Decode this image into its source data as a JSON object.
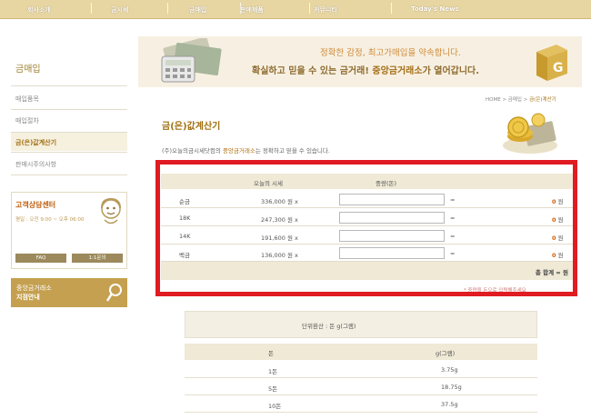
{
  "nav": {
    "items": [
      "회사소개",
      "금시세",
      "금매입",
      "판매제품",
      "커뮤니티",
      "Today's News"
    ]
  },
  "sidebar": {
    "title": "금매입",
    "items": [
      {
        "label": "매입품목",
        "active": false
      },
      {
        "label": "매입절차",
        "active": false
      },
      {
        "label": "금(은)값계산기",
        "active": true
      },
      {
        "label": "판매시주의사항",
        "active": false
      }
    ],
    "cs": {
      "title": "고객상담센터",
      "hours": "평일 : 오전 9:00 ~ 오후 06:00",
      "faq": "FAQ",
      "qna": "1:1문의"
    },
    "branch": {
      "line1": "중앙금거래소",
      "line2": "지점안내"
    }
  },
  "banner": {
    "line1": "정확한 감정, 최고가매입을 약속합니다.",
    "line2_pre": "확실하고 믿을 수 있는 금거래! ",
    "line2_hl": "중앙금거래소",
    "line2_post": "가 열어갑니다."
  },
  "breadcrumb": {
    "home": "HOME",
    "sep": ">",
    "mid": "금매입",
    "current": "금(은)계산기"
  },
  "page": {
    "title": "금(은)값계산기",
    "desc_pre": "(주)오늘의금시세닷컴의 ",
    "desc_hl": "중앙금거래소",
    "desc_post": "는 정확하고 믿을 수 있습니다."
  },
  "calc": {
    "header_price": "오늘의 시세",
    "header_weight": "중량(돈)",
    "price_suffix": "원 x",
    "eq": "=",
    "unit": "원",
    "rows": [
      {
        "name": "순금",
        "price": "336,000",
        "result": "0"
      },
      {
        "name": "18K",
        "price": "247,300",
        "result": "0"
      },
      {
        "name": "14K",
        "price": "191,600",
        "result": "0"
      },
      {
        "name": "백금",
        "price": "136,000",
        "result": "0"
      }
    ],
    "total": "총 합계 = 원",
    "note": "* 중량을 돈으로 입력해주세요"
  },
  "unit_table": {
    "caption": "단위환산 : 돈 g(그램)",
    "col1": "돈",
    "col2": "g(그램)",
    "rows": [
      {
        "don": "1돈",
        "gram": "3.75g"
      },
      {
        "don": "5돈",
        "gram": "18.75g"
      },
      {
        "don": "10돈",
        "gram": "37.5g"
      }
    ]
  },
  "colors": {
    "nav_bg": "#e7d5a2",
    "accent": "#a07010",
    "red_frame": "#e01b22",
    "result_num": "#d05a00"
  }
}
